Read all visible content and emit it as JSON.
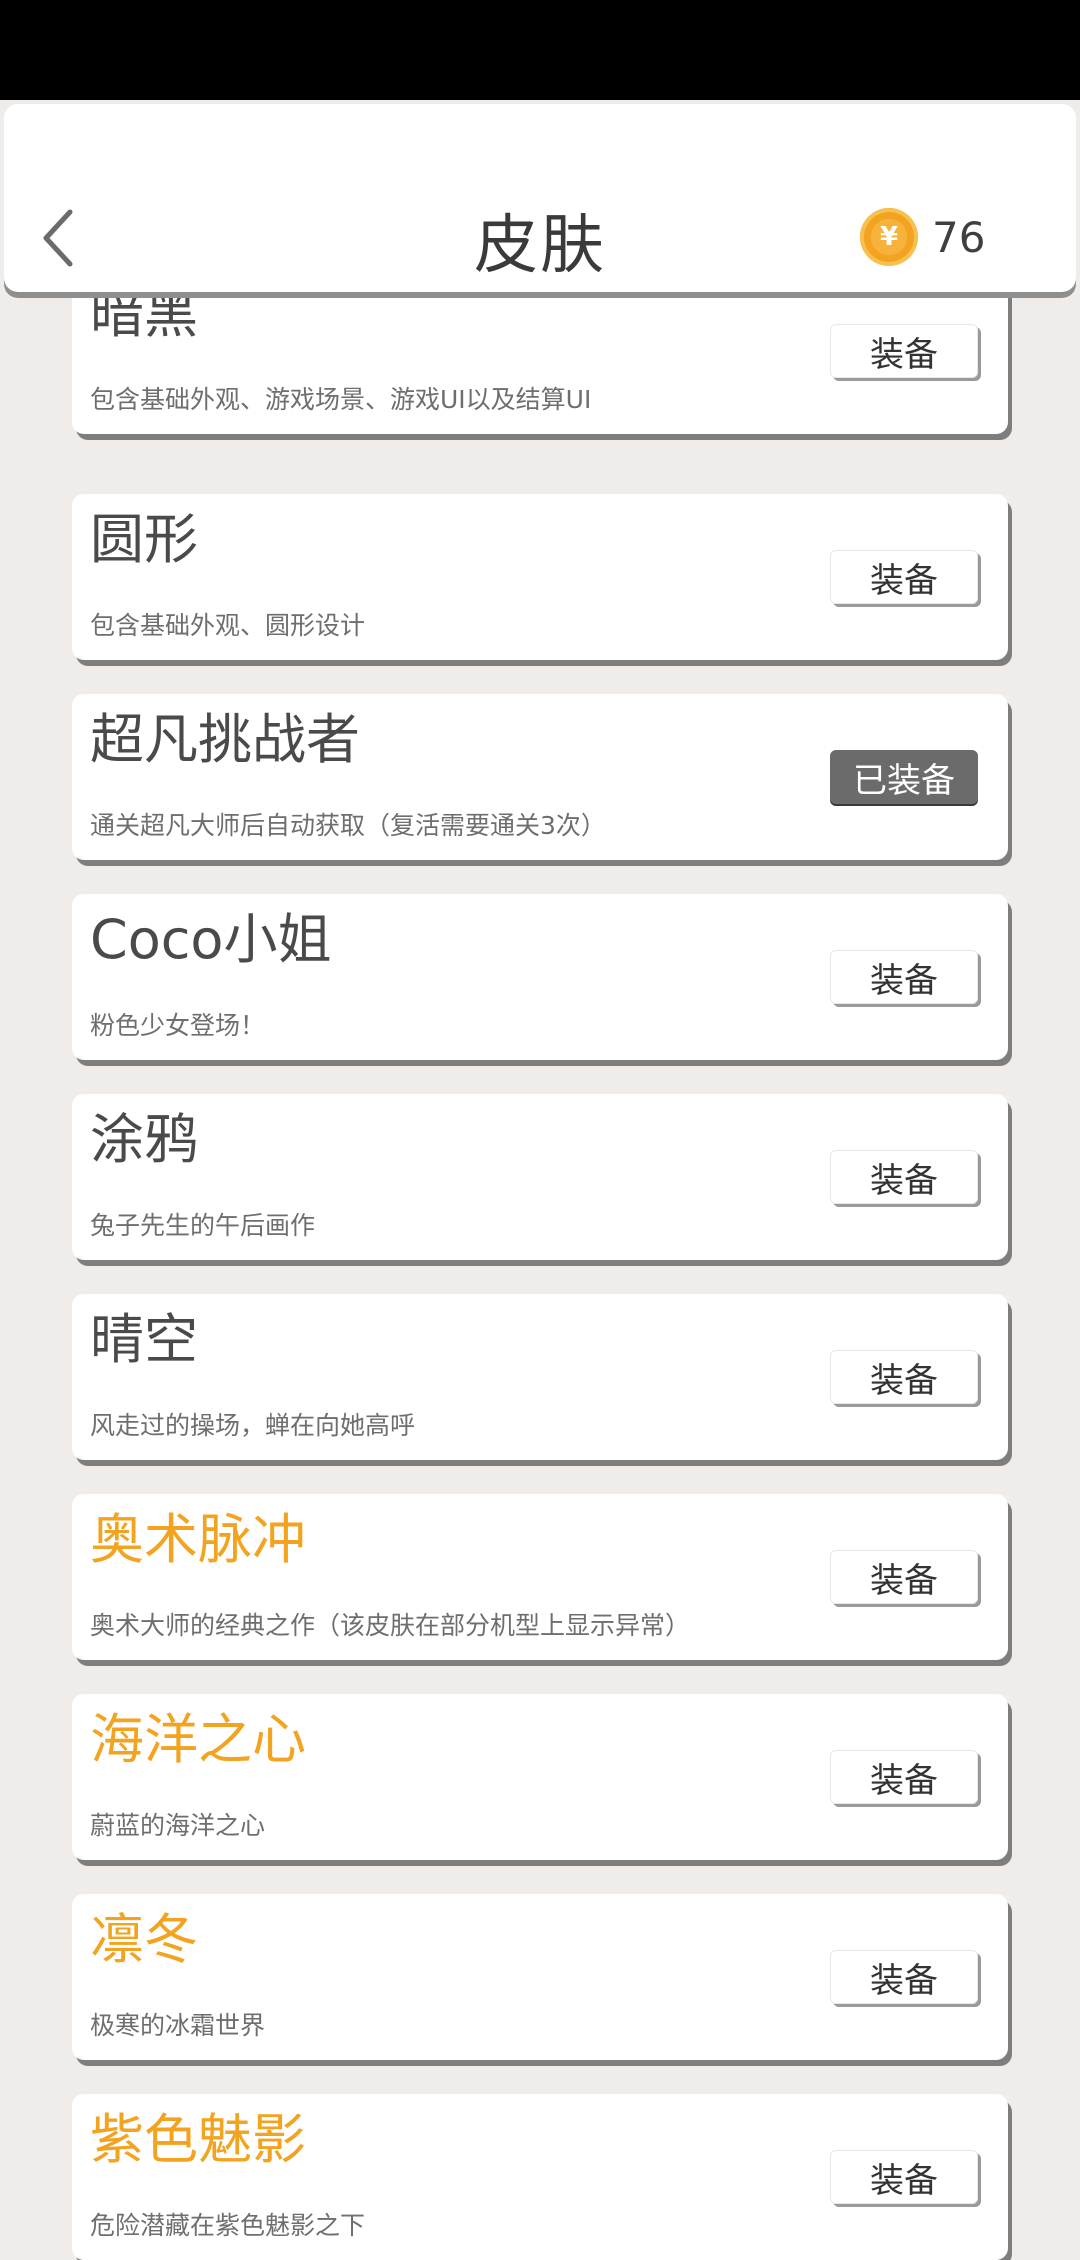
{
  "header": {
    "title": "皮肤",
    "coin_count": "76",
    "coin_symbol": "¥"
  },
  "skins": [
    {
      "name": "暗黑",
      "desc": "包含基础外观、游戏场景、游戏UI以及结算UI",
      "button": "装备",
      "equipped": false,
      "premium": false
    },
    {
      "name": "圆形",
      "desc": "包含基础外观、圆形设计",
      "button": "装备",
      "equipped": false,
      "premium": false
    },
    {
      "name": "超凡挑战者",
      "desc": "通关超凡大师后自动获取（复活需要通关3次）",
      "button": "已装备",
      "equipped": true,
      "premium": false
    },
    {
      "name": "Coco小姐",
      "desc": "粉色少女登场！",
      "button": "装备",
      "equipped": false,
      "premium": false
    },
    {
      "name": "涂鸦",
      "desc": "兔子先生的午后画作",
      "button": "装备",
      "equipped": false,
      "premium": false
    },
    {
      "name": "晴空",
      "desc": "风走过的操场，蝉在向她高呼",
      "button": "装备",
      "equipped": false,
      "premium": false
    },
    {
      "name": "奥术脉冲",
      "desc": "奥术大师的经典之作（该皮肤在部分机型上显示异常）",
      "button": "装备",
      "equipped": false,
      "premium": true
    },
    {
      "name": "海洋之心",
      "desc": "蔚蓝的海洋之心",
      "button": "装备",
      "equipped": false,
      "premium": true
    },
    {
      "name": "凛冬",
      "desc": "极寒的冰霜世界",
      "button": "装备",
      "equipped": false,
      "premium": true
    },
    {
      "name": "紫色魅影",
      "desc": "危险潜藏在紫色魅影之下",
      "button": "装备",
      "equipped": false,
      "premium": true
    }
  ],
  "colors": {
    "premium_name": "#f2a320",
    "equipped_button": "#6b6b6b",
    "coin": "#f2a31f"
  },
  "icons": {
    "back": "chevron-left-icon",
    "coin": "coin-icon"
  }
}
